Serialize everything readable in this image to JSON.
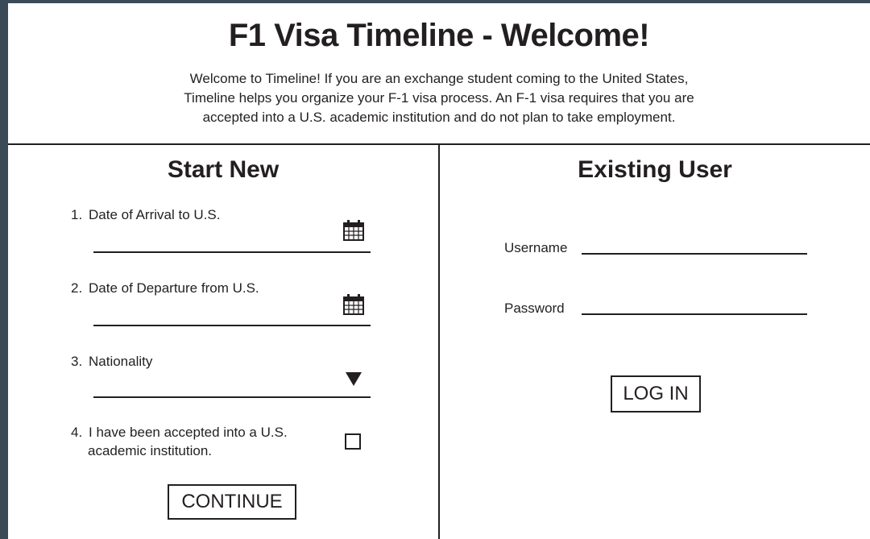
{
  "header": {
    "title": "F1 Visa Timeline - Welcome!",
    "intro_line1": "Welcome to Timeline! If you are an exchange student coming to the United States,",
    "intro_line2": "Timeline helps you organize your F-1 visa process. An F-1 visa requires that you are",
    "intro_line3": "accepted into a U.S. academic institution and do not plan to take employment."
  },
  "start_new": {
    "title": "Start New",
    "fields": [
      {
        "number": "1.",
        "label": "Date of Arrival to U.S.",
        "value": "",
        "icon": "calendar-icon"
      },
      {
        "number": "2.",
        "label": "Date of Departure from U.S.",
        "value": "",
        "icon": "calendar-icon"
      },
      {
        "number": "3.",
        "label": "Nationality",
        "value": "",
        "icon": "dropdown-arrow-icon"
      }
    ],
    "checkbox": {
      "number": "4.",
      "label_line1": "I have been accepted into a U.S.",
      "label_line2": "academic institution.",
      "checked": false
    },
    "continue_label": "CONTINUE"
  },
  "existing_user": {
    "title": "Existing User",
    "username_label": "Username",
    "username_value": "",
    "password_label": "Password",
    "password_value": "",
    "login_label": "LOG IN"
  }
}
